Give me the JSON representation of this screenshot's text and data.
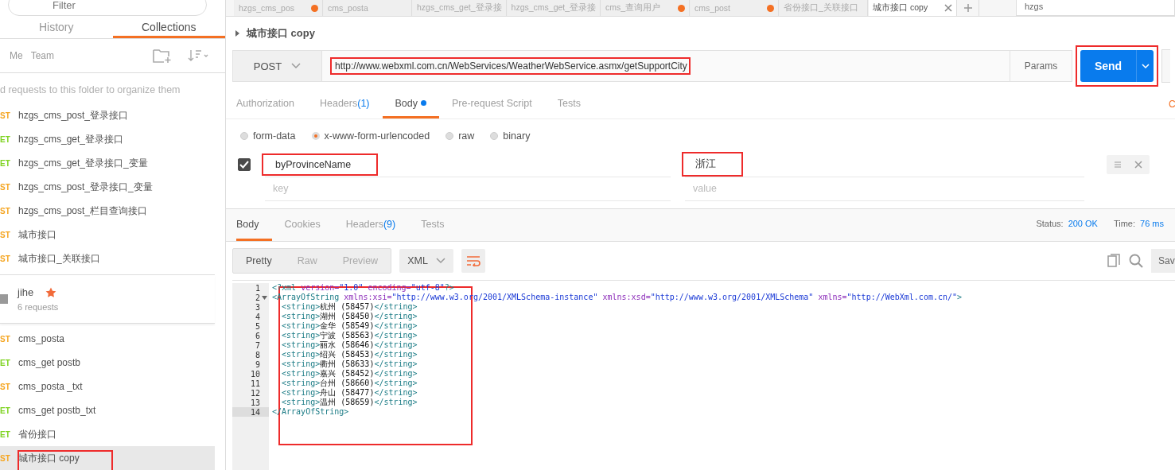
{
  "sidebar": {
    "filter": {
      "placeholder": "Filter"
    },
    "tabs": [
      {
        "label": "History",
        "selected": false
      },
      {
        "label": "Collections",
        "selected": true
      }
    ],
    "owners": [
      "Me",
      "Team"
    ],
    "hint": "d requests to this folder to organize them",
    "requests": [
      {
        "method": "ST",
        "kind": "post",
        "name": "hzgs_cms_post_登录接口",
        "selected": false,
        "highlighted": false
      },
      {
        "method": "ET",
        "kind": "get",
        "name": "hzgs_cms_get_登录接口",
        "selected": false,
        "highlighted": false
      },
      {
        "method": "ET",
        "kind": "get",
        "name": "hzgs_cms_get_登录接口_变量",
        "selected": false,
        "highlighted": false
      },
      {
        "method": "ST",
        "kind": "post",
        "name": "hzgs_cms_post_登录接口_变量",
        "selected": false,
        "highlighted": false
      },
      {
        "method": "ST",
        "kind": "post",
        "name": "hzgs_cms_post_栏目查询接口",
        "selected": false,
        "highlighted": false
      },
      {
        "method": "ST",
        "kind": "post",
        "name": "城市接口",
        "selected": false,
        "highlighted": false
      },
      {
        "method": "ST",
        "kind": "post",
        "name": "城市接口_关联接口",
        "selected": false,
        "highlighted": false
      }
    ],
    "folder": {
      "name": "jihe",
      "starred": true,
      "count": "6 requests"
    },
    "folder_requests": [
      {
        "method": "ST",
        "kind": "post",
        "name": "cms_posta",
        "selected": false,
        "highlighted": false
      },
      {
        "method": "ET",
        "kind": "get",
        "name": "cms_get postb",
        "selected": false,
        "highlighted": false
      },
      {
        "method": "ST",
        "kind": "post",
        "name": "cms_posta _txt",
        "selected": false,
        "highlighted": false
      },
      {
        "method": "ET",
        "kind": "get",
        "name": "cms_get postb_txt",
        "selected": false,
        "highlighted": false
      },
      {
        "method": "ET",
        "kind": "get",
        "name": "省份接口",
        "selected": false,
        "highlighted": false
      },
      {
        "method": "ST",
        "kind": "post",
        "name": "城市接口 copy",
        "selected": true,
        "highlighted": true
      }
    ]
  },
  "tabs": [
    {
      "label": "hzgs_cms_pos",
      "unsaved": true,
      "selected": false
    },
    {
      "label": "cms_posta",
      "unsaved": false,
      "selected": false
    },
    {
      "label": "hzgs_cms_get_登录接",
      "unsaved": false,
      "selected": false
    },
    {
      "label": "hzgs_cms_get_登录接",
      "unsaved": false,
      "selected": false
    },
    {
      "label": "cms_查询用户",
      "unsaved": true,
      "selected": false
    },
    {
      "label": "cms_post",
      "unsaved": true,
      "selected": false
    },
    {
      "label": "省份接口_关联接口",
      "unsaved": false,
      "selected": false
    },
    {
      "label": "城市接口 copy",
      "unsaved": false,
      "selected": true
    }
  ],
  "search": {
    "value": "hzgs"
  },
  "request": {
    "title": "城市接口 copy",
    "method": "POST",
    "url": "http://www.webxml.com.cn/WebServices/WeatherWebService.asmx/getSupportCity",
    "url_highlighted": true,
    "params_button": "Params",
    "send": "Send",
    "send_highlighted": true,
    "tabs": [
      {
        "label": "Authorization",
        "dot": false,
        "selected": false
      },
      {
        "label": "Headers",
        "badge": "(1)",
        "dot": false,
        "selected": false
      },
      {
        "label": "Body",
        "dot": true,
        "selected": true
      },
      {
        "label": "Pre-request Script",
        "dot": false,
        "selected": false
      },
      {
        "label": "Tests",
        "dot": false,
        "selected": false
      }
    ],
    "cookies_link": "C",
    "body_types": [
      {
        "label": "form-data",
        "selected": false
      },
      {
        "label": "x-www-form-urlencoded",
        "selected": true
      },
      {
        "label": "raw",
        "selected": false
      },
      {
        "label": "binary",
        "selected": false
      }
    ],
    "params": [
      {
        "key": "byProvinceName",
        "value": "浙江",
        "checked": true,
        "key_highlighted": true,
        "value_highlighted": true
      }
    ],
    "new_row": {
      "key_placeholder": "key",
      "value_placeholder": "value"
    }
  },
  "response": {
    "tabs": [
      {
        "label": "Body",
        "selected": true
      },
      {
        "label": "Cookies",
        "selected": false
      },
      {
        "label": "Headers",
        "badge": "(9)",
        "selected": false
      },
      {
        "label": "Tests",
        "selected": false
      }
    ],
    "status_label": "Status:",
    "status": "200 OK",
    "time_label": "Time:",
    "time": "76 ms",
    "views": [
      {
        "label": "Pretty",
        "selected": true
      },
      {
        "label": "Raw",
        "selected": false
      },
      {
        "label": "Preview",
        "selected": false
      }
    ],
    "format": "XML",
    "save": "Sav",
    "code_highlighted": true,
    "lines": [
      {
        "number": "1",
        "text": "<?xml version=\"1.0\" encoding=\"utf-8\"?>",
        "foldable": false,
        "active": false
      },
      {
        "number": "2",
        "text": "<ArrayOfString xmlns:xsi=\"http://www.w3.org/2001/XMLSchema-instance\" xmlns:xsd=\"http://www.w3.org/2001/XMLSchema\" xmlns=\"http://WebXml.com.cn/\">",
        "foldable": true,
        "active": false
      },
      {
        "number": "3",
        "text": "  <string>杭州 (58457)</string>",
        "foldable": false,
        "active": false
      },
      {
        "number": "4",
        "text": "  <string>湖州 (58450)</string>",
        "foldable": false,
        "active": false
      },
      {
        "number": "5",
        "text": "  <string>金华 (58549)</string>",
        "foldable": false,
        "active": false
      },
      {
        "number": "6",
        "text": "  <string>宁波 (58563)</string>",
        "foldable": false,
        "active": false
      },
      {
        "number": "7",
        "text": "  <string>丽水 (58646)</string>",
        "foldable": false,
        "active": false
      },
      {
        "number": "8",
        "text": "  <string>绍兴 (58453)</string>",
        "foldable": false,
        "active": false
      },
      {
        "number": "9",
        "text": "  <string>衢州 (58633)</string>",
        "foldable": false,
        "active": false
      },
      {
        "number": "10",
        "text": "  <string>嘉兴 (58452)</string>",
        "foldable": false,
        "active": false
      },
      {
        "number": "11",
        "text": "  <string>台州 (58660)</string>",
        "foldable": false,
        "active": false
      },
      {
        "number": "12",
        "text": "  <string>舟山 (58477)</string>",
        "foldable": false,
        "active": false
      },
      {
        "number": "13",
        "text": "  <string>温州 (58659)</string>",
        "foldable": false,
        "active": false
      },
      {
        "number": "14",
        "text": "</ArrayOfString>",
        "foldable": false,
        "active": true
      }
    ]
  }
}
